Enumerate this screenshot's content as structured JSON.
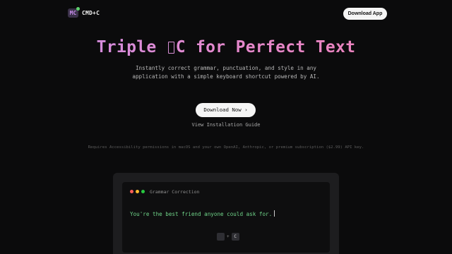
{
  "nav": {
    "logo_mark": "MC",
    "brand": "CMD+C",
    "download_label": "Download App"
  },
  "hero": {
    "title_before": "Triple ",
    "title_after": "C for Perfect Text",
    "subtitle": "Instantly correct grammar, punctuation, and style in any application with a simple keyboard shortcut powered by AI.",
    "cta_label": "Download Now ›",
    "guide_label": "View Installation Guide",
    "requirements": "Requires Accessibility permissions in macOS and your own OpenAI, Anthropic, or premium subscription ($2.99) API key."
  },
  "demo": {
    "window_title": "Grammar Correction",
    "text": "You're the best friend anyone could ask for.",
    "keys": [
      "",
      "C"
    ],
    "key_separator": "+"
  },
  "colors": {
    "accent_gradient_start": "#c98ee8",
    "accent_gradient_end": "#f07fb4",
    "corrected_text": "#6fd489",
    "background": "#0b0b0c"
  }
}
